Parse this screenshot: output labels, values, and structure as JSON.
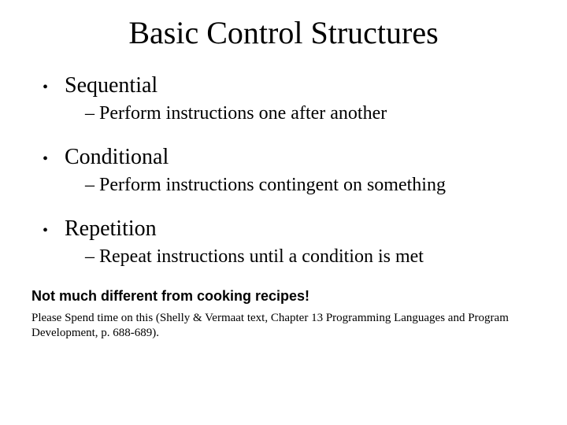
{
  "title": "Basic Control Structures",
  "bullets": [
    {
      "label": "Sequential",
      "sub": "Perform instructions one after another"
    },
    {
      "label": "Conditional",
      "sub": "Perform instructions contingent on something"
    },
    {
      "label": "Repetition",
      "sub": "Repeat instructions until a condition is met"
    }
  ],
  "note_bold": "Not much different from cooking recipes!",
  "note_small": "Please Spend time on this (Shelly & Vermaat text, Chapter 13 Programming Languages and Program Development, p. 688-689)."
}
